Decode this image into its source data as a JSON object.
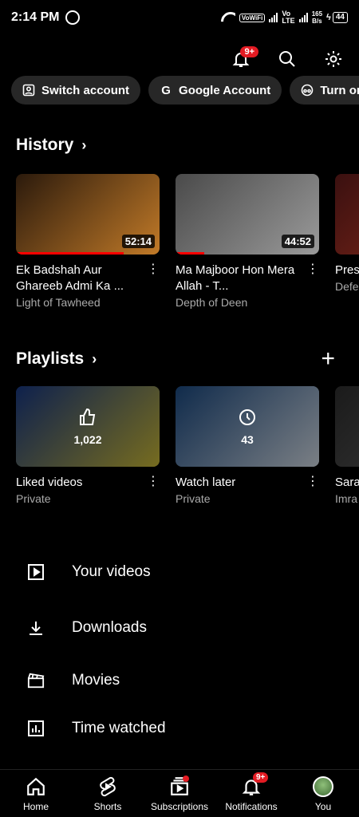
{
  "status_bar": {
    "time": "2:14 PM",
    "network_tag": "VoWiFi",
    "lte_top": "Vo",
    "lte_bottom": "LTE",
    "speed_value": "165",
    "speed_unit": "B/s",
    "battery": "44"
  },
  "header": {
    "notifications_badge": "9+",
    "icons": [
      "bell-icon",
      "search-icon",
      "gear-icon"
    ]
  },
  "account_chips": [
    {
      "label": "Switch account",
      "icon": "switch-account-icon"
    },
    {
      "label": "Google Account",
      "icon": "google-icon"
    },
    {
      "label": "Turn on In",
      "icon": "incognito-icon"
    }
  ],
  "history": {
    "title": "History",
    "videos": [
      {
        "title": "Ek Badshah Aur Ghareeb Admi Ka ...",
        "channel": "Light of Tawheed",
        "duration": "52:14",
        "progress": 0.75,
        "thumb_colors": [
          "#2b1a0c",
          "#c17a28"
        ]
      },
      {
        "title": "Ma Majboor Hon Mera Allah - T...",
        "channel": "Depth of Deen",
        "duration": "44:52",
        "progress": 0.2,
        "thumb_colors": [
          "#4a4a4a",
          "#9a9a9a"
        ]
      },
      {
        "title": "Pres & Xi",
        "channel": "Defe",
        "duration": "",
        "progress": 0,
        "thumb_colors": [
          "#3a1010",
          "#8a2a1a"
        ]
      }
    ]
  },
  "playlists": {
    "title": "Playlists",
    "items": [
      {
        "title": "Liked videos",
        "subtitle": "Private",
        "count": "1,022",
        "icon": "thumbs-up-icon",
        "thumb_colors": [
          "#1a3c8c",
          "#d8c53a"
        ]
      },
      {
        "title": "Watch later",
        "subtitle": "Private",
        "count": "43",
        "icon": "clock-icon",
        "thumb_colors": [
          "#1e4f8a",
          "#dfe8f2"
        ]
      },
      {
        "title": "Sara Slow",
        "subtitle": "Imra",
        "count": "",
        "icon": "",
        "thumb_colors": [
          "#1b1b1b",
          "#3a3a3a"
        ]
      }
    ]
  },
  "menu": [
    {
      "label": "Your videos",
      "icon": "play-square-icon"
    },
    {
      "label": "Downloads",
      "icon": "download-icon"
    },
    {
      "label": "Movies",
      "icon": "clapperboard-icon"
    },
    {
      "label": "Time watched",
      "icon": "bar-chart-icon"
    }
  ],
  "bottom_nav": [
    {
      "label": "Home",
      "icon": "home-icon"
    },
    {
      "label": "Shorts",
      "icon": "shorts-icon"
    },
    {
      "label": "Subscriptions",
      "icon": "subscriptions-icon"
    },
    {
      "label": "Notifications",
      "icon": "bell-icon",
      "badge": "9+"
    },
    {
      "label": "You",
      "icon": "avatar"
    }
  ]
}
